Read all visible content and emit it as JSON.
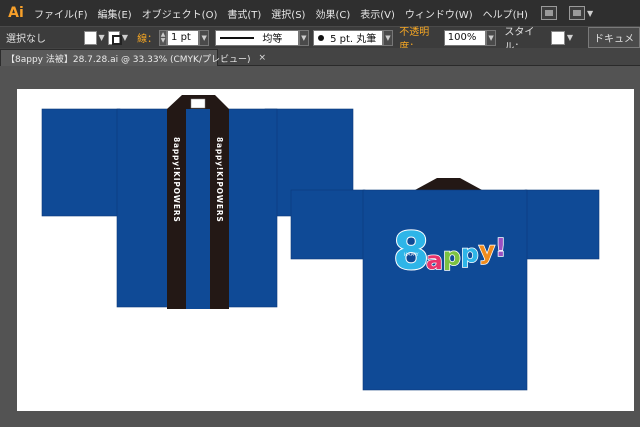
{
  "app": {
    "logo": "Ai"
  },
  "menu": {
    "items": [
      "ファイル(F)",
      "編集(E)",
      "オブジェクト(O)",
      "書式(T)",
      "選択(S)",
      "効果(C)",
      "表示(V)",
      "ウィンドウ(W)",
      "ヘルプ(H)"
    ]
  },
  "control": {
    "selection": "選択なし",
    "stroke_label": "線：",
    "stroke_weight": "1 pt",
    "stroke_style": "均等",
    "brush": "5 pt. 丸筆",
    "opacity_label": "不透明度：",
    "opacity": "100%",
    "style_label": "スタイル：",
    "doc_button": "ドキュメ"
  },
  "tab": {
    "title": "【8appy 法被】28.7.28.ai @ 33.33% (CMYK/プレビュー)",
    "close": "×"
  },
  "artwork": {
    "collar_text": "8appy!KIPOWERS",
    "logo_main": "8",
    "logo_word": "appy!",
    "logo_small": "HAPPY",
    "colors": {
      "happi_blue": "#0f4a96",
      "collar_black": "#231815",
      "canvas_gray": "#535353",
      "artboard": "#ffffff",
      "accent_orange": "#f5a623"
    }
  }
}
